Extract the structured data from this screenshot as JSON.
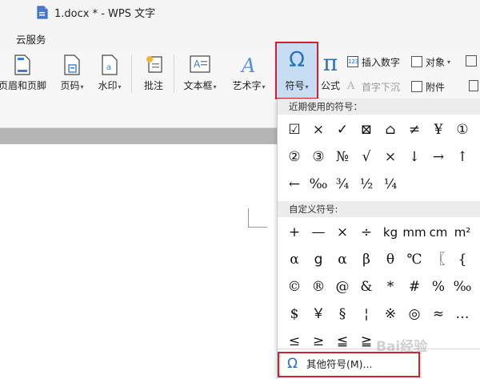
{
  "window": {
    "title": "1.docx * - WPS 文字"
  },
  "menu": {
    "cloud_service": "云服务"
  },
  "ribbon": {
    "header_footer": "页眉和页脚",
    "page_number": "页码",
    "watermark": "水印",
    "comment": "批注",
    "textbox": "文本框",
    "wordart": "艺术字",
    "symbol": "符号",
    "formula": "公式",
    "insert_number": "插入数字",
    "object": "对象",
    "drop_cap": "首字下沉",
    "attachment": "附件",
    "caret": "▾"
  },
  "symbol_panel": {
    "recent_label": "近期使用的符号：",
    "recent_symbols": [
      "☑",
      "×",
      "✓",
      "⊠",
      "⌂",
      "≠",
      "¥",
      "①",
      "②",
      "③",
      "№",
      "√",
      "×",
      "↓",
      "→",
      "↑",
      "←",
      "‰",
      "¾",
      "½",
      "¼"
    ],
    "custom_label": "自定义符号:",
    "custom_symbols": [
      "+",
      "—",
      "×",
      "÷",
      "kg",
      "mm",
      "cm",
      "m²",
      "α",
      "g",
      "α",
      "β",
      "θ",
      "℃",
      "〖",
      "{",
      "©",
      "®",
      "@",
      "&",
      "*",
      "#",
      "%",
      "‰",
      "$",
      "￥",
      "§",
      "¦",
      "※",
      "◎",
      "≈",
      "…",
      "≤",
      "≥",
      "≦",
      "≧"
    ],
    "more_symbols": "其他符号(M)...",
    "omega": "Ω"
  },
  "watermark_text": "Bai经验",
  "colors": {
    "highlight_border": "#d4202a",
    "selected_bg": "#c7ddf3",
    "accent_blue": "#2a6fc0"
  }
}
